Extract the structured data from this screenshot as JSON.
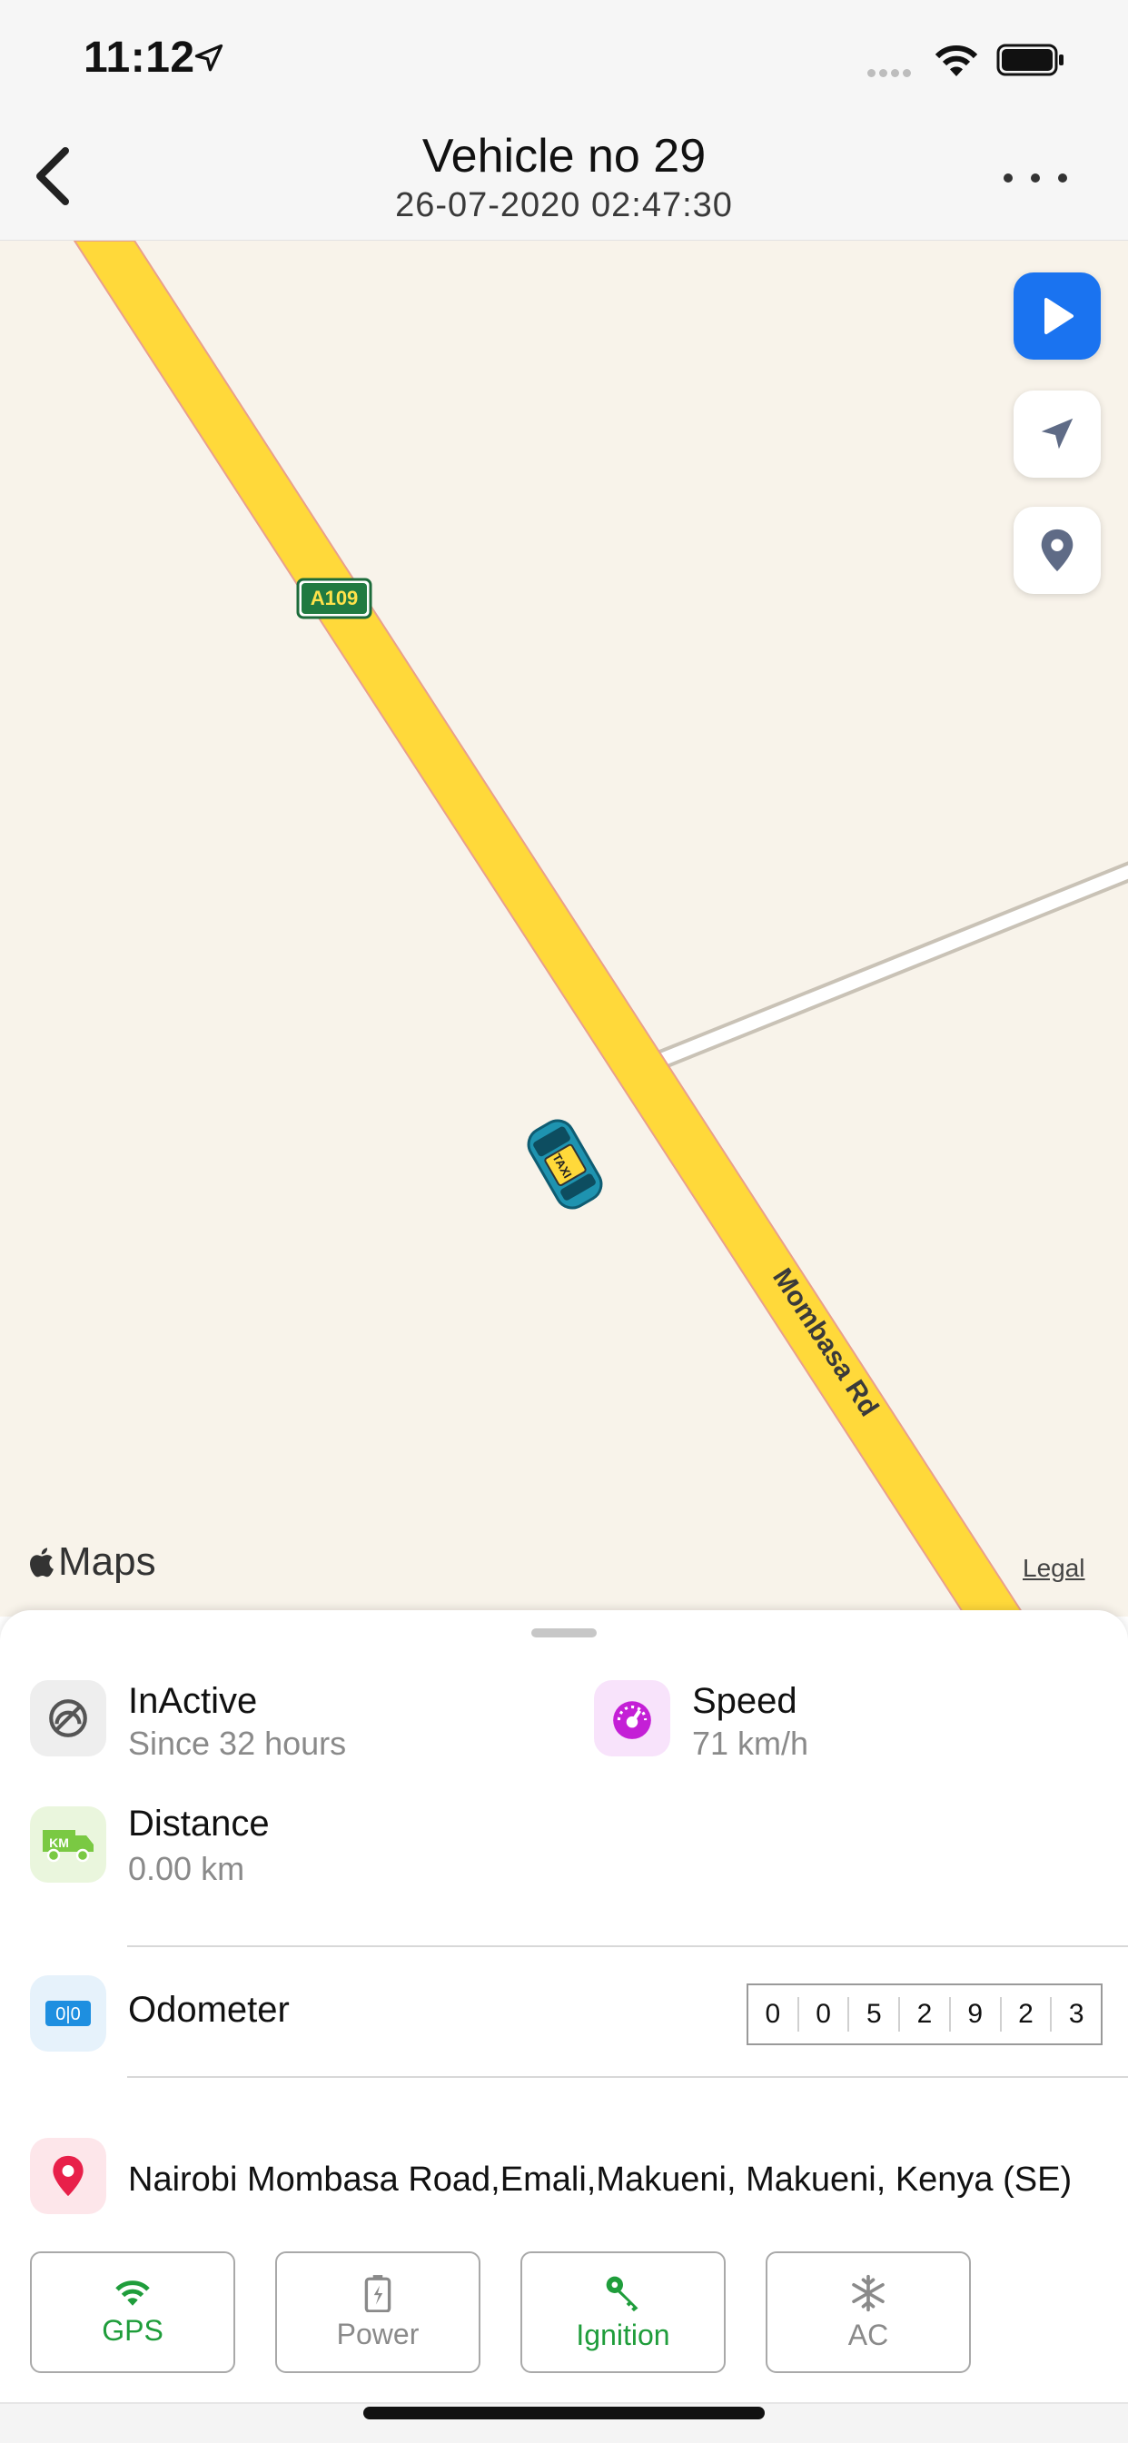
{
  "status_bar": {
    "time": "11:12"
  },
  "nav": {
    "title": "Vehicle no 29",
    "subtitle": "26-07-2020 02:47:30"
  },
  "map": {
    "route_shield": "A109",
    "road_name": "Mombasa Rd",
    "vehicle_badge": "TAXI",
    "attribution": "Maps",
    "legal_link": "Legal",
    "controls": [
      "play-icon",
      "navigation-arrow-icon",
      "location-pin-icon"
    ]
  },
  "info": {
    "status": {
      "label": "InActive",
      "value": "Since 32 hours"
    },
    "speed": {
      "label": "Speed",
      "value": "71 km/h"
    },
    "distance": {
      "label": "Distance",
      "value": "0.00 km",
      "icon_text": "KM"
    },
    "odometer": {
      "label": "Odometer",
      "icon_text": "0|0",
      "digits": [
        "0",
        "0",
        "5",
        "2",
        "9",
        "2",
        "3"
      ]
    },
    "address": "Nairobi  Mombasa Road,Emali,Makueni, Makueni, Kenya (SE)"
  },
  "chips": [
    {
      "label": "GPS",
      "state": "on"
    },
    {
      "label": "Power",
      "state": "off"
    },
    {
      "label": "Ignition",
      "state": "on"
    },
    {
      "label": "AC",
      "state": "off"
    }
  ],
  "colors": {
    "accent_blue": "#1a73f0",
    "road_yellow": "#ffd93a",
    "map_bg": "#f8f3ea",
    "active_green": "#1f9d3b",
    "pin_red": "#e8204a"
  }
}
